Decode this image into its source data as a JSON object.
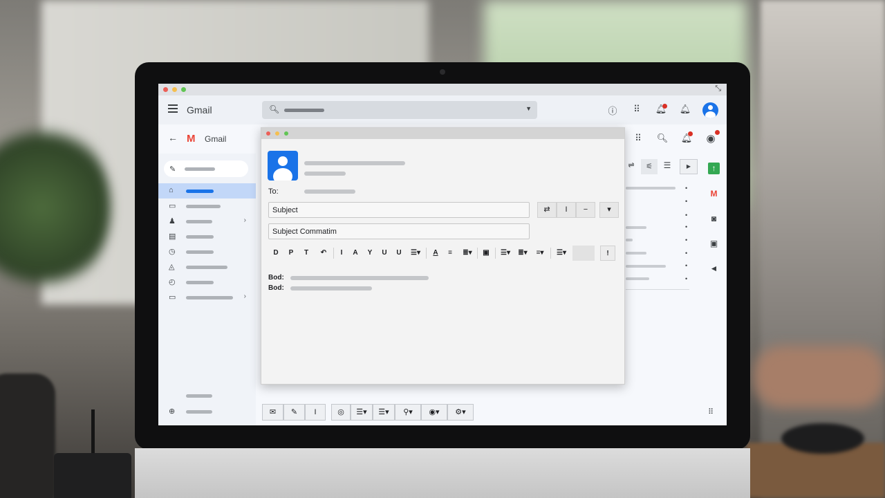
{
  "window": {
    "title_bar_colors": [
      "#ec5f57",
      "#f5bf4f",
      "#61c554"
    ]
  },
  "appbar": {
    "menu_icon": "hamburger-icon",
    "brand": "Gmail",
    "search_icon": "search-icon",
    "actions": [
      "help-icon",
      "apps-grid-icon",
      "notifications-icon",
      "bell-icon",
      "account-avatar"
    ]
  },
  "subbar": {
    "back_icon": "back-arrow-icon",
    "logo_letter": "M",
    "brand": "Gmail",
    "actions": [
      "apps-grid-icon",
      "search-icon",
      "notifications-icon",
      "account-avatar"
    ]
  },
  "compose": {
    "to_label": "To:",
    "subject_value": "Subject",
    "subject2_value": "Subject Commatim",
    "top_buttons": [
      "⇄",
      "I",
      "−",
      "▾"
    ],
    "format_buttons": [
      "D",
      "P",
      "T",
      "↶",
      "I",
      "A",
      "Y",
      "U",
      "U"
    ],
    "body_labels": [
      "Bod:",
      "Bod:"
    ]
  },
  "bottom_toolbar": {
    "buttons": [
      "✉",
      "✎",
      "I",
      "◎",
      "☰▾",
      "☰▾",
      "⚲▾",
      "◉▾",
      "⚙▾"
    ]
  },
  "colors": {
    "accent": "#1a73e8",
    "nav_active": "#c2d7f8",
    "badge": "#d93025",
    "gmail_red": "#ea4335"
  }
}
